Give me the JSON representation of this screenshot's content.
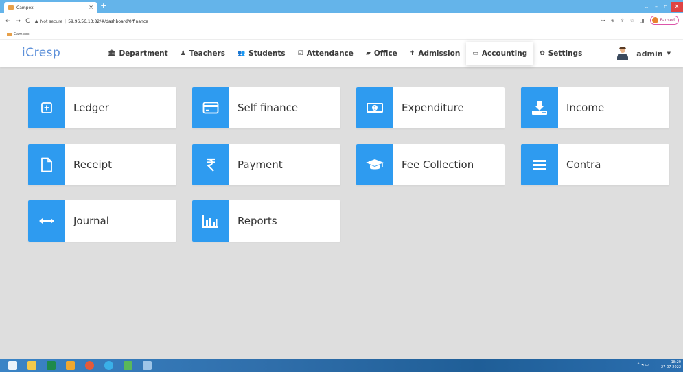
{
  "browser": {
    "tab_title": "Campex",
    "new_tab": "+",
    "close_tab": "×",
    "nav_back": "←",
    "nav_forward": "→",
    "reload": "C",
    "security": "Not secure",
    "url": "59.96.56.13:82/#/dashboard/0/finance",
    "bookmark": "Campex",
    "profile_status": "Paused",
    "win_minimize": "–",
    "win_restore": "▫",
    "win_close": "✕",
    "toolbar_icons": [
      "⊶",
      "⊕",
      "⇪",
      "☆",
      "◨"
    ]
  },
  "app": {
    "logo": "iCresp",
    "nav": [
      {
        "label": "Department",
        "icon": "🏛"
      },
      {
        "label": "Teachers",
        "icon": "♟"
      },
      {
        "label": "Students",
        "icon": "👥"
      },
      {
        "label": "Attendance",
        "icon": "☑"
      },
      {
        "label": "Office",
        "icon": "▰"
      },
      {
        "label": "Admission",
        "icon": "✝"
      },
      {
        "label": "Accounting",
        "icon": "▭"
      },
      {
        "label": "Settings",
        "icon": "✿"
      }
    ],
    "active_nav": "Accounting",
    "user": "admin"
  },
  "cards": [
    {
      "label": "Ledger",
      "icon": "ledger-icon"
    },
    {
      "label": "Self finance",
      "icon": "credit-card-icon"
    },
    {
      "label": "Expenditure",
      "icon": "money-icon"
    },
    {
      "label": "Income",
      "icon": "download-icon"
    },
    {
      "label": "Receipt",
      "icon": "document-icon"
    },
    {
      "label": "Payment",
      "icon": "rupee-icon"
    },
    {
      "label": "Fee Collection",
      "icon": "graduation-cap-icon"
    },
    {
      "label": "Contra",
      "icon": "menu-icon"
    },
    {
      "label": "Journal",
      "icon": "arrows-horizontal-icon"
    },
    {
      "label": "Reports",
      "icon": "bar-chart-icon"
    }
  ],
  "taskbar": {
    "time": "18:20",
    "date": "27-07-2022"
  },
  "colors": {
    "accent": "#2e9bf0",
    "background": "#dedede",
    "tab_bar": "#64b4ea"
  }
}
